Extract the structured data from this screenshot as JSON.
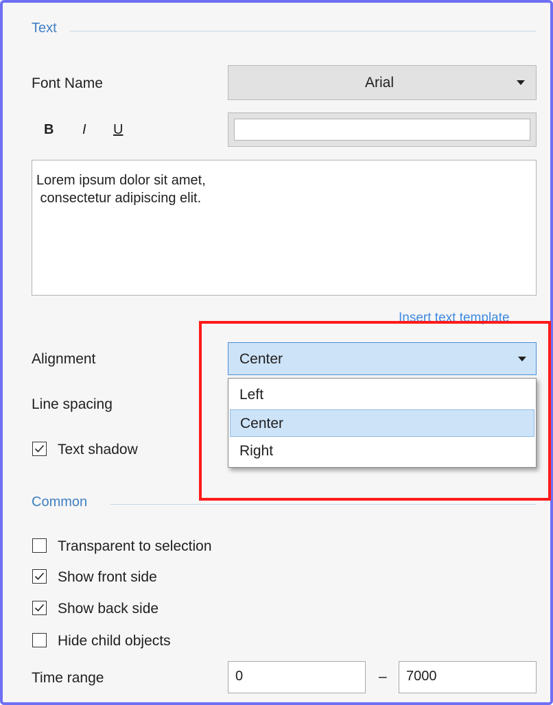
{
  "text_section": {
    "title": "Text",
    "font_name_label": "Font Name",
    "font_value": "Arial",
    "bold_label": "B",
    "italic_label": "I",
    "underline_label": "U",
    "font_size_value": "",
    "body_text": "Lorem ipsum dolor sit amet,\n consectetur adipiscing elit.",
    "insert_template_link": "Insert text template",
    "alignment_label": "Alignment",
    "alignment_value": "Center",
    "alignment_options": [
      "Left",
      "Center",
      "Right"
    ],
    "line_spacing_label": "Line spacing",
    "text_shadow_label": "Text shadow",
    "text_shadow_checked": true
  },
  "common_section": {
    "title": "Common",
    "transparent_label": "Transparent to selection",
    "show_front_label": "Show front side",
    "show_back_label": "Show back side",
    "hide_children_label": "Hide child objects",
    "time_range_label": "Time range",
    "time_from": "0",
    "time_separator": "–",
    "time_to": "7000"
  },
  "colors": {
    "accent": "#3f7fc2",
    "highlight": "#ff1a1a",
    "frame": "#6f6ff4"
  }
}
